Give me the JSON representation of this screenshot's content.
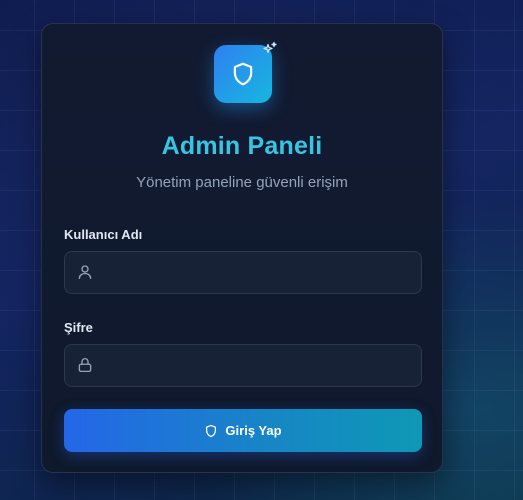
{
  "header": {
    "title": "Admin Paneli",
    "subtitle": "Yönetim paneline güvenli erişim"
  },
  "form": {
    "username": {
      "label": "Kullanıcı Adı",
      "value": "",
      "placeholder": "",
      "icon": "user-icon"
    },
    "password": {
      "label": "Şifre",
      "value": "",
      "placeholder": "",
      "icon": "lock-icon"
    },
    "submit": {
      "label": "Giriş Yap",
      "icon": "shield-icon"
    }
  },
  "colors": {
    "accent": "#38c5e3",
    "logo_gradient_start": "#2f80f0",
    "logo_gradient_end": "#16b7e0",
    "button_gradient_start": "#2566e8",
    "button_gradient_end": "#0e98b6",
    "card_background": "#121a31"
  },
  "icons": {
    "logo": "shield-icon",
    "logo_badge": "sparkles-icon"
  }
}
